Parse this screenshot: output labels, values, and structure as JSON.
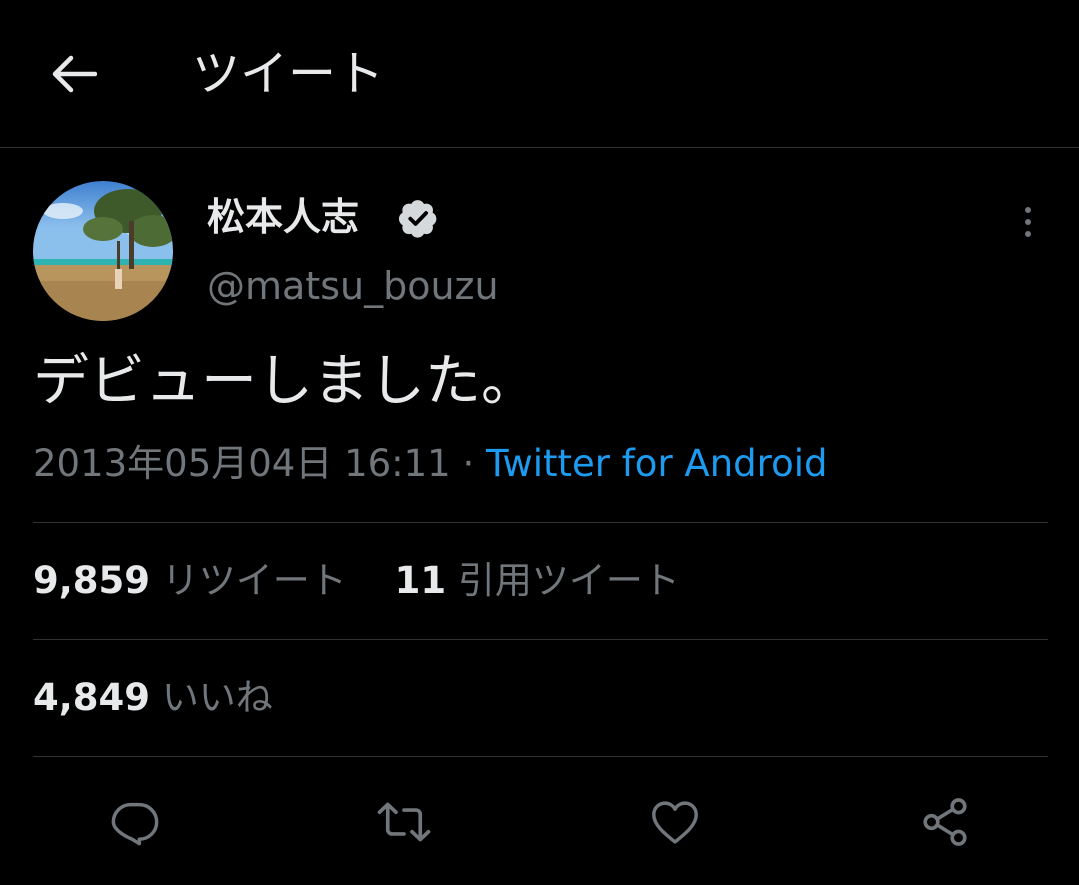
{
  "header": {
    "title": "ツイート",
    "back_icon": "arrow-left-icon"
  },
  "author": {
    "display_name": "松本人志",
    "handle": "@matsu_bouzu",
    "verified": true
  },
  "tweet": {
    "text": "デビューしました。",
    "timestamp": "2013年05月04日 16:11",
    "separator": "·",
    "source": "Twitter for Android"
  },
  "stats": {
    "retweets_count": "9,859",
    "retweets_label": "リツイート",
    "quotes_count": "11",
    "quotes_label": "引用ツイート",
    "likes_count": "4,849",
    "likes_label": "いいね"
  },
  "actions": [
    "reply-icon",
    "retweet-icon",
    "like-icon",
    "share-icon"
  ],
  "colors": {
    "background": "#000000",
    "text": "#e7e9ea",
    "secondary": "#71767b",
    "link": "#1d9bf0",
    "divider": "#2f3336"
  }
}
